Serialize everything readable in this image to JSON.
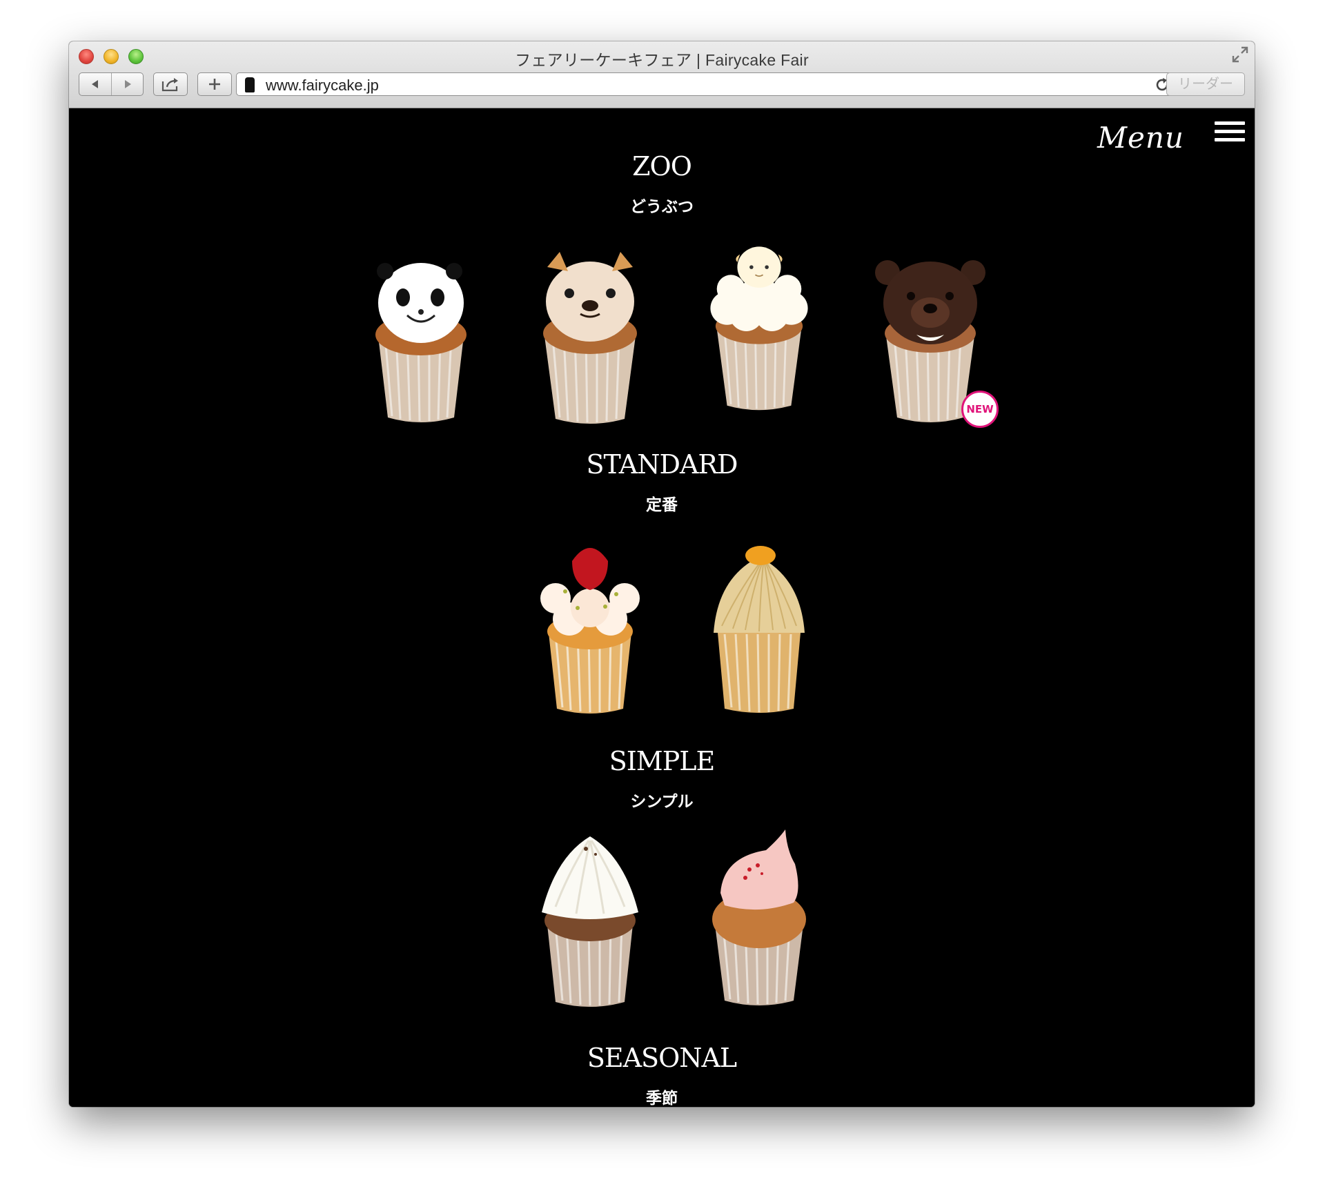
{
  "browser": {
    "window_title": "フェアリーケーキフェア | Fairycake Fair",
    "url": "www.fairycake.jp",
    "reader_label": "リーダー"
  },
  "page": {
    "menu_label": "Menu",
    "sections": [
      {
        "title": "ZOO",
        "subtitle": "どうぶつ"
      },
      {
        "title": "STANDARD",
        "subtitle": "定番"
      },
      {
        "title": "SIMPLE",
        "subtitle": "シンプル"
      },
      {
        "title": "SEASONAL",
        "subtitle": "季節"
      }
    ],
    "new_badge": "NEW"
  },
  "colors": {
    "background": "#000000",
    "badge_accent": "#e0147a",
    "text": "#ffffff"
  }
}
